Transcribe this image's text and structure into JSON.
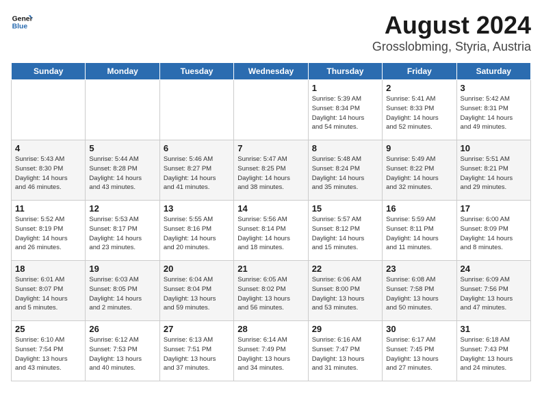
{
  "header": {
    "logo_line1": "General",
    "logo_line2": "Blue",
    "title": "August 2024",
    "subtitle": "Grosslobming, Styria, Austria"
  },
  "weekdays": [
    "Sunday",
    "Monday",
    "Tuesday",
    "Wednesday",
    "Thursday",
    "Friday",
    "Saturday"
  ],
  "weeks": [
    [
      {
        "day": "",
        "text": ""
      },
      {
        "day": "",
        "text": ""
      },
      {
        "day": "",
        "text": ""
      },
      {
        "day": "",
        "text": ""
      },
      {
        "day": "1",
        "text": "Sunrise: 5:39 AM\nSunset: 8:34 PM\nDaylight: 14 hours\nand 54 minutes."
      },
      {
        "day": "2",
        "text": "Sunrise: 5:41 AM\nSunset: 8:33 PM\nDaylight: 14 hours\nand 52 minutes."
      },
      {
        "day": "3",
        "text": "Sunrise: 5:42 AM\nSunset: 8:31 PM\nDaylight: 14 hours\nand 49 minutes."
      }
    ],
    [
      {
        "day": "4",
        "text": "Sunrise: 5:43 AM\nSunset: 8:30 PM\nDaylight: 14 hours\nand 46 minutes."
      },
      {
        "day": "5",
        "text": "Sunrise: 5:44 AM\nSunset: 8:28 PM\nDaylight: 14 hours\nand 43 minutes."
      },
      {
        "day": "6",
        "text": "Sunrise: 5:46 AM\nSunset: 8:27 PM\nDaylight: 14 hours\nand 41 minutes."
      },
      {
        "day": "7",
        "text": "Sunrise: 5:47 AM\nSunset: 8:25 PM\nDaylight: 14 hours\nand 38 minutes."
      },
      {
        "day": "8",
        "text": "Sunrise: 5:48 AM\nSunset: 8:24 PM\nDaylight: 14 hours\nand 35 minutes."
      },
      {
        "day": "9",
        "text": "Sunrise: 5:49 AM\nSunset: 8:22 PM\nDaylight: 14 hours\nand 32 minutes."
      },
      {
        "day": "10",
        "text": "Sunrise: 5:51 AM\nSunset: 8:21 PM\nDaylight: 14 hours\nand 29 minutes."
      }
    ],
    [
      {
        "day": "11",
        "text": "Sunrise: 5:52 AM\nSunset: 8:19 PM\nDaylight: 14 hours\nand 26 minutes."
      },
      {
        "day": "12",
        "text": "Sunrise: 5:53 AM\nSunset: 8:17 PM\nDaylight: 14 hours\nand 23 minutes."
      },
      {
        "day": "13",
        "text": "Sunrise: 5:55 AM\nSunset: 8:16 PM\nDaylight: 14 hours\nand 20 minutes."
      },
      {
        "day": "14",
        "text": "Sunrise: 5:56 AM\nSunset: 8:14 PM\nDaylight: 14 hours\nand 18 minutes."
      },
      {
        "day": "15",
        "text": "Sunrise: 5:57 AM\nSunset: 8:12 PM\nDaylight: 14 hours\nand 15 minutes."
      },
      {
        "day": "16",
        "text": "Sunrise: 5:59 AM\nSunset: 8:11 PM\nDaylight: 14 hours\nand 11 minutes."
      },
      {
        "day": "17",
        "text": "Sunrise: 6:00 AM\nSunset: 8:09 PM\nDaylight: 14 hours\nand 8 minutes."
      }
    ],
    [
      {
        "day": "18",
        "text": "Sunrise: 6:01 AM\nSunset: 8:07 PM\nDaylight: 14 hours\nand 5 minutes."
      },
      {
        "day": "19",
        "text": "Sunrise: 6:03 AM\nSunset: 8:05 PM\nDaylight: 14 hours\nand 2 minutes."
      },
      {
        "day": "20",
        "text": "Sunrise: 6:04 AM\nSunset: 8:04 PM\nDaylight: 13 hours\nand 59 minutes."
      },
      {
        "day": "21",
        "text": "Sunrise: 6:05 AM\nSunset: 8:02 PM\nDaylight: 13 hours\nand 56 minutes."
      },
      {
        "day": "22",
        "text": "Sunrise: 6:06 AM\nSunset: 8:00 PM\nDaylight: 13 hours\nand 53 minutes."
      },
      {
        "day": "23",
        "text": "Sunrise: 6:08 AM\nSunset: 7:58 PM\nDaylight: 13 hours\nand 50 minutes."
      },
      {
        "day": "24",
        "text": "Sunrise: 6:09 AM\nSunset: 7:56 PM\nDaylight: 13 hours\nand 47 minutes."
      }
    ],
    [
      {
        "day": "25",
        "text": "Sunrise: 6:10 AM\nSunset: 7:54 PM\nDaylight: 13 hours\nand 43 minutes."
      },
      {
        "day": "26",
        "text": "Sunrise: 6:12 AM\nSunset: 7:53 PM\nDaylight: 13 hours\nand 40 minutes."
      },
      {
        "day": "27",
        "text": "Sunrise: 6:13 AM\nSunset: 7:51 PM\nDaylight: 13 hours\nand 37 minutes."
      },
      {
        "day": "28",
        "text": "Sunrise: 6:14 AM\nSunset: 7:49 PM\nDaylight: 13 hours\nand 34 minutes."
      },
      {
        "day": "29",
        "text": "Sunrise: 6:16 AM\nSunset: 7:47 PM\nDaylight: 13 hours\nand 31 minutes."
      },
      {
        "day": "30",
        "text": "Sunrise: 6:17 AM\nSunset: 7:45 PM\nDaylight: 13 hours\nand 27 minutes."
      },
      {
        "day": "31",
        "text": "Sunrise: 6:18 AM\nSunset: 7:43 PM\nDaylight: 13 hours\nand 24 minutes."
      }
    ]
  ]
}
